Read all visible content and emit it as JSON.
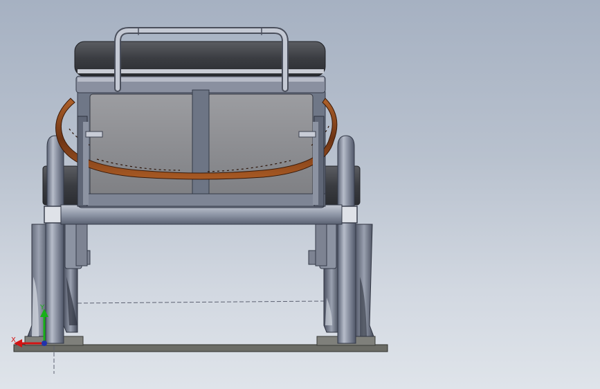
{
  "viewport": {
    "background_top": "#a6b1c2",
    "background_bottom": "#dfe4ea"
  },
  "model": {
    "frame_color": "#6f7787",
    "seat_color": "#3f4146",
    "strap_color": "#8a4a1f",
    "base_color": "#6b6c66"
  },
  "triad": {
    "x_label": "X",
    "y_label": "Y",
    "x_color": "#d21414",
    "y_color": "#18b018"
  }
}
